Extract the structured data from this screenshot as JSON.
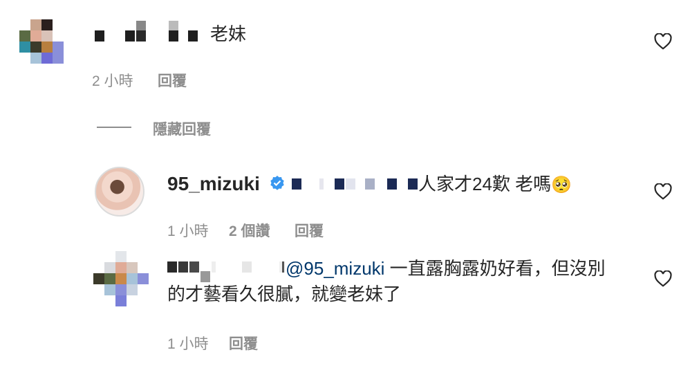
{
  "comments": [
    {
      "text": "老妹",
      "time": "2 小時",
      "reply_label": "回覆"
    }
  ],
  "hide_replies_label": "隱藏回覆",
  "reply": {
    "username": "95_mizuki",
    "text": "人家才24歎 老嗎",
    "emoji": "🥺",
    "time": "1 小時",
    "likes": "2 個讚",
    "reply_label": "回覆"
  },
  "reply2": {
    "mention": "@95_mizuki",
    "text_line1": " 一直露胸露奶好看，但沒別",
    "text_line2": "的才藝看久很膩，就變老妹了",
    "time": "1 小時",
    "reply_label": "回覆"
  },
  "colors": {
    "text": "#262626",
    "secondary": "#8e8e8e",
    "mention": "#00376b",
    "verified": "#3897f0"
  },
  "icons": [
    "heart-icon",
    "verified-icon"
  ]
}
